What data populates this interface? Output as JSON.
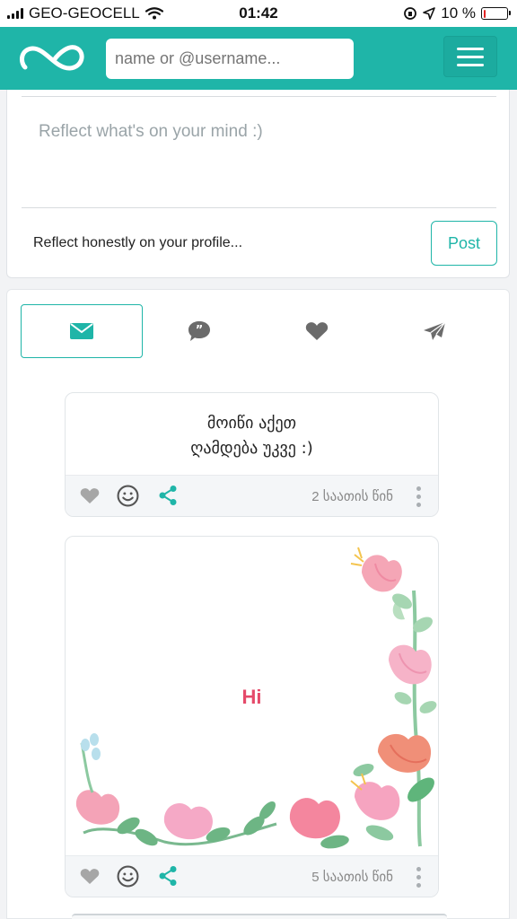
{
  "status_bar": {
    "carrier": "GEO-GEOCELL",
    "time": "01:42",
    "battery": "10 %",
    "battery_level": 0.1
  },
  "header": {
    "search_placeholder": "name or @username...",
    "logo_icon": "infinity-logo",
    "menu_icon": "hamburger-menu-icon",
    "brand_color": "#1fb5a8"
  },
  "composer": {
    "placeholder": "Reflect what's on your mind :)",
    "hint": "Reflect honestly on your profile...",
    "post_label": "Post"
  },
  "tabs": [
    {
      "icon": "envelope-icon",
      "active": true
    },
    {
      "icon": "speech-bubble-icon",
      "active": false
    },
    {
      "icon": "heart-icon",
      "active": false
    },
    {
      "icon": "paper-plane-icon",
      "active": false
    }
  ],
  "posts": [
    {
      "text_line1": "მოიწი აქეთ",
      "text_line2": "ღამდება უკვე :)",
      "time": "2 საათის წინ"
    },
    {
      "text": "Hi",
      "time": "5 საათის წინ",
      "background": "floral-frame"
    }
  ]
}
